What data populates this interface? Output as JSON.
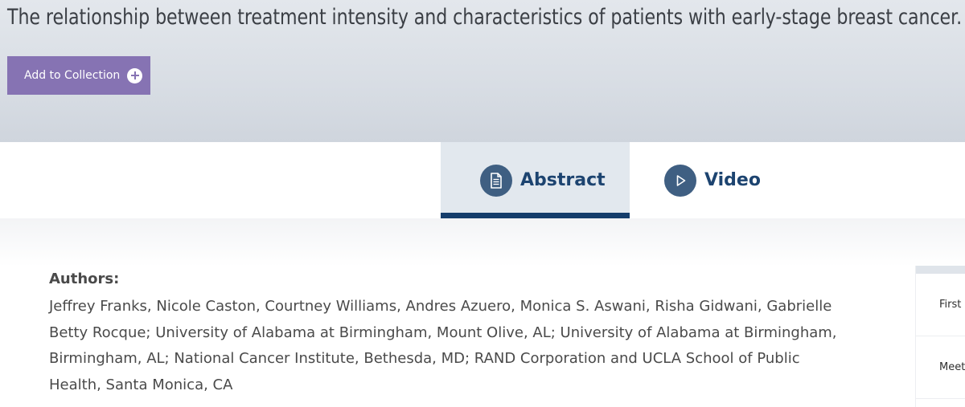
{
  "header": {
    "title": "The relationship between treatment intensity and characteristics of patients with early-stage breast cancer.",
    "add_button_label": "Add to Collection"
  },
  "tabs": [
    {
      "label": "Abstract",
      "icon": "document-icon",
      "active": true
    },
    {
      "label": "Video",
      "icon": "play-icon",
      "active": false
    }
  ],
  "authors": {
    "heading": "Authors:",
    "text": "Jeffrey Franks, Nicole Caston, Courtney Williams, Andres Azuero, Monica S. Aswani, Risha Gidwani, Gabrielle Betty Rocque; University of Alabama at Birmingham, Mount Olive, AL; University of Alabama at Birmingham, Birmingham, AL; National Cancer Institute, Bethesda, MD; RAND Corporation and UCLA School of Public Health, Santa Monica, CA"
  },
  "side_panel": {
    "rows": [
      "First",
      "Meet"
    ]
  },
  "colors": {
    "accent_purple": "#8673b3",
    "tab_blue": "#153d6b",
    "icon_circle": "#3f5f82"
  }
}
